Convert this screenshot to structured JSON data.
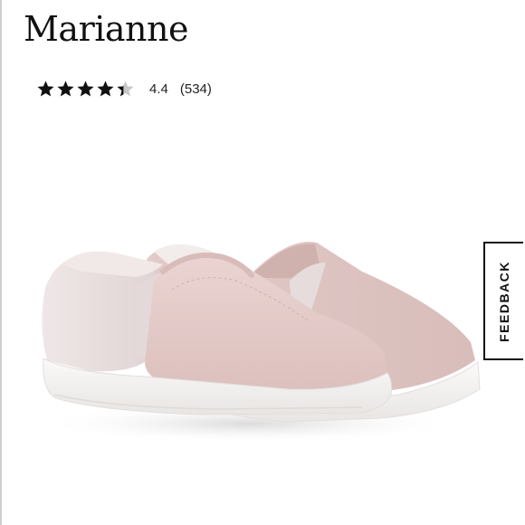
{
  "product": {
    "title": "Marianne",
    "rating": {
      "stars_filled_fraction": 0.88,
      "value_label": "4.4",
      "count_label": "(534)",
      "star_color": "#111111",
      "star_empty_color": "#c8c8c8"
    },
    "image": {
      "subject": "pair of blush pink suede slip-on sneakers with white soles",
      "upper_color": "#e6cfcd",
      "heel_color": "#e9dfdf",
      "sole_color": "#f4f2f1"
    }
  },
  "feedback": {
    "label": "FEEDBACK"
  }
}
